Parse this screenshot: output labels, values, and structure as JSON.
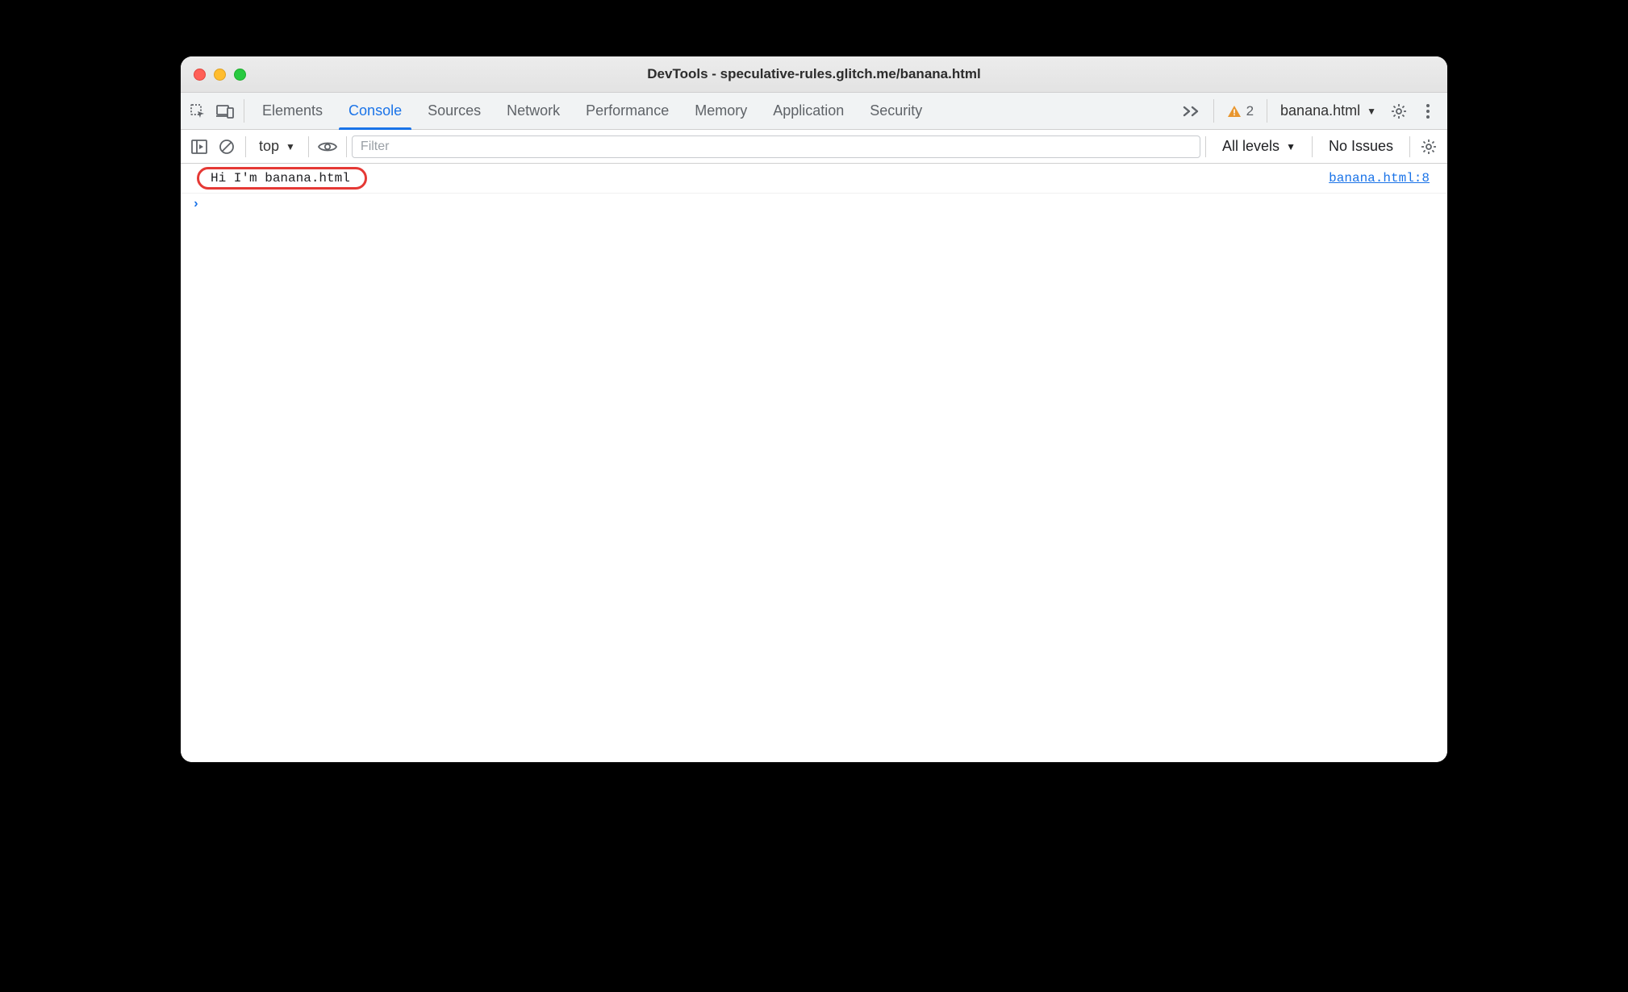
{
  "window": {
    "title": "DevTools - speculative-rules.glitch.me/banana.html"
  },
  "tabs": {
    "items": [
      "Elements",
      "Console",
      "Sources",
      "Network",
      "Performance",
      "Memory",
      "Application",
      "Security"
    ],
    "active_index": 1
  },
  "tabstrip_right": {
    "warning_count": "2",
    "context_label": "banana.html"
  },
  "console_toolbar": {
    "execution_context": "top",
    "filter_placeholder": "Filter",
    "levels_label": "All levels",
    "issues_label": "No Issues"
  },
  "console": {
    "log_message": "Hi I'm banana.html",
    "log_source": "banana.html:8"
  }
}
